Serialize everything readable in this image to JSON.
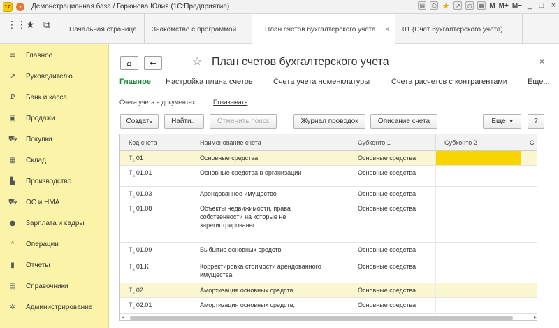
{
  "titlebar": {
    "title": "Демонстрационная база / Горюнова Юлия   (1С:Предприятие)",
    "logo_text": "1C",
    "m_label": "M",
    "mplus_label": "M+",
    "mminus_label": "M−",
    "minimize": "_",
    "maximize": "□",
    "close": "×"
  },
  "tabs": [
    {
      "label": "Начальная страница"
    },
    {
      "label": "Знакомство с программой"
    },
    {
      "label": "План счетов бухгалтерского учета",
      "close": "×"
    },
    {
      "label": "01 (Счет бухгалтерского учета)"
    }
  ],
  "sidebar": {
    "items": [
      {
        "icon": "≡",
        "label": "Главное"
      },
      {
        "icon": "↗",
        "label": "Руководителю"
      },
      {
        "icon": "₽",
        "label": "Банк и касса"
      },
      {
        "icon": "▣",
        "label": "Продажи"
      },
      {
        "icon": "⛟",
        "label": "Покупки"
      },
      {
        "icon": "▦",
        "label": "Склад"
      },
      {
        "icon": "▙",
        "label": "Производство"
      },
      {
        "icon": "⛟",
        "label": "ОС и НМА"
      },
      {
        "icon": "●",
        "label": "Зарплата и кадры"
      },
      {
        "icon": "ᴬ",
        "label": "Операции"
      },
      {
        "icon": "▮",
        "label": "Отчеты"
      },
      {
        "icon": "▤",
        "label": "Справочники"
      },
      {
        "icon": "✲",
        "label": "Администрирование"
      }
    ]
  },
  "form": {
    "home_icon": "⌂",
    "back_icon": "←",
    "star_icon": "☆",
    "title": "План счетов бухгалтерского учета",
    "close": "×",
    "tabs": [
      "Главное",
      "Настройка плана счетов",
      "Счета учета номенклатуры",
      "Счета расчетов с контрагентами",
      "Еще..."
    ],
    "accounts_label": "Счета учета в документах:",
    "accounts_link": "Показывать",
    "buttons": {
      "create": "Создать",
      "find": "Найти...",
      "cancel_search": "Отменить поиск",
      "journal": "Журнал проводок",
      "description": "Описание счета",
      "more": "Еще",
      "more_caret": "▾",
      "help": "?"
    }
  },
  "grid": {
    "columns": [
      "Код счета",
      "Наименование счета",
      "Субконто 1",
      "Субконто 2",
      "С"
    ],
    "rows": [
      {
        "code": "01",
        "name": "Основные средства",
        "sub1": "Основные средства",
        "sub2": ""
      },
      {
        "code": "01.01",
        "name": "Основные средства в организации",
        "sub1": "Основные средства",
        "sub2": ""
      },
      {
        "code": "01.03",
        "name": "Арендованное имущество",
        "sub1": "Основные средства",
        "sub2": ""
      },
      {
        "code": "01.08",
        "name": "Объекты недвижимости, права собственности на которые не зарегистрированы",
        "sub1": "Основные средства",
        "sub2": ""
      },
      {
        "code": "01.09",
        "name": "Выбытие основных средств",
        "sub1": "Основные средства",
        "sub2": ""
      },
      {
        "code": "01.К",
        "name": "Корректировка стоимости арендованного имущества",
        "sub1": "Основные средства",
        "sub2": ""
      },
      {
        "code": "02",
        "name": "Амортизация основных средств",
        "sub1": "Основные средства",
        "sub2": ""
      },
      {
        "code": "02.01",
        "name": "Амортизация основных средств,",
        "sub1": "Основные средства",
        "sub2": ""
      }
    ],
    "t_symbol": "Т",
    "t_sub": "а"
  }
}
